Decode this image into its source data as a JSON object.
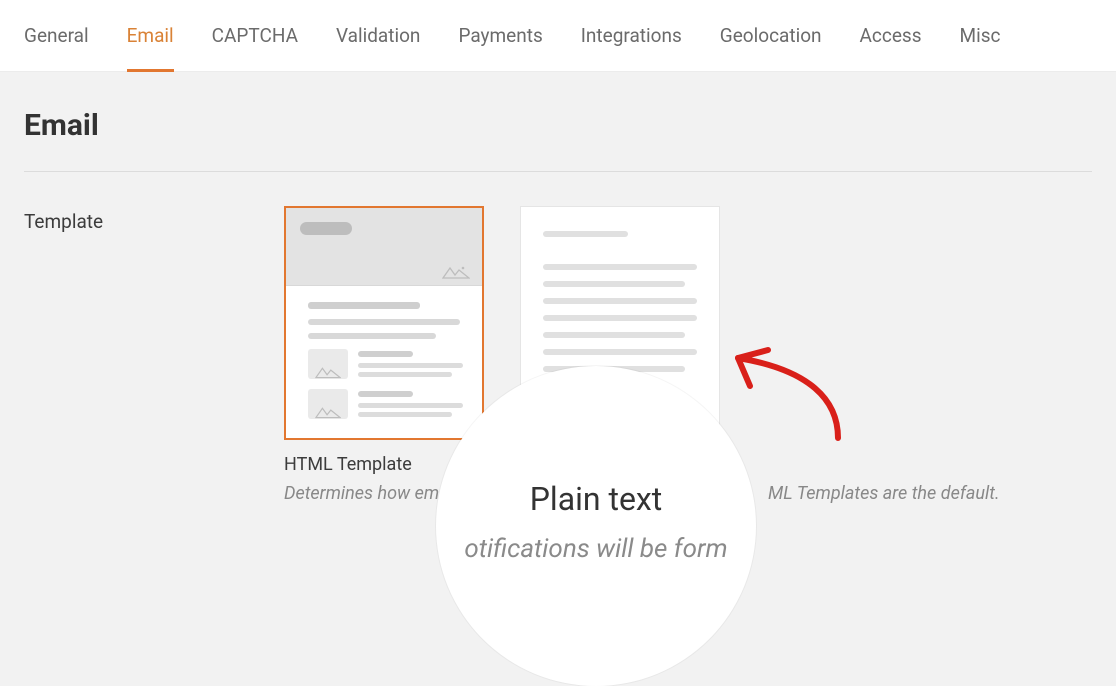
{
  "tabs": {
    "items": [
      {
        "label": "General"
      },
      {
        "label": "Email"
      },
      {
        "label": "CAPTCHA"
      },
      {
        "label": "Validation"
      },
      {
        "label": "Payments"
      },
      {
        "label": "Integrations"
      },
      {
        "label": "Geolocation"
      },
      {
        "label": "Access"
      },
      {
        "label": "Misc"
      }
    ],
    "active_index": 1
  },
  "section": {
    "title": "Email"
  },
  "template_row": {
    "label": "Template",
    "options": {
      "html": {
        "caption": "HTML Template",
        "selected": true
      },
      "plain": {
        "caption": "Plain text",
        "selected": false
      }
    },
    "description_left": "Determines how em",
    "description_right": "ML Templates are the default.",
    "magnifier": {
      "title": "Plain text",
      "subtitle": "otifications will be form"
    }
  }
}
